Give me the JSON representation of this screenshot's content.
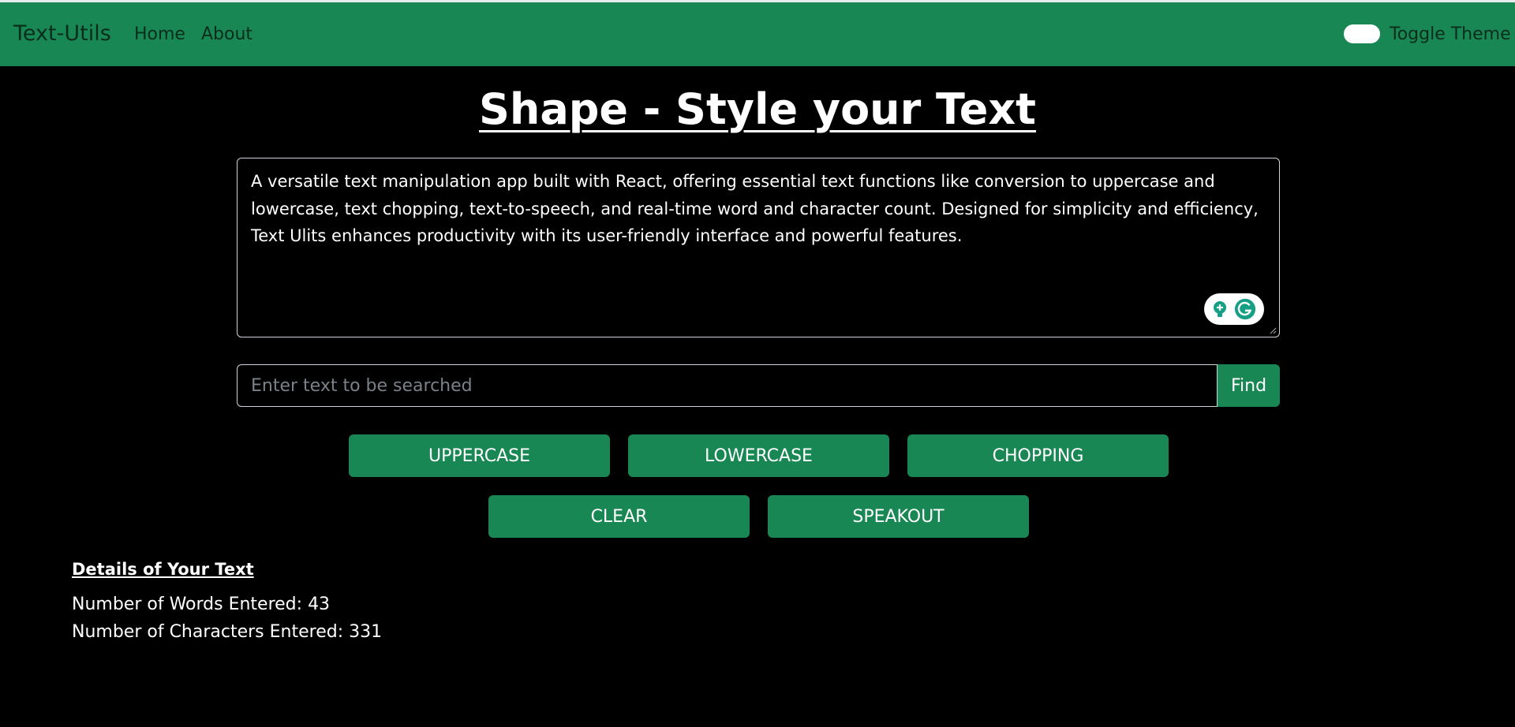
{
  "navbar": {
    "brand": "Text-Utils",
    "links": [
      "Home",
      "About"
    ],
    "toggle_label": "Toggle Theme"
  },
  "main": {
    "title": "Shape - Style your Text",
    "textarea_text": "A versatile text manipulation app built with React, offering essential text functions like conversion to uppercase and lowercase, text chopping, text-to-speech, and real-time word and character count. Designed for simplicity and efficiency, Text Ulits enhances productivity with its user-friendly interface and powerful features.",
    "search": {
      "placeholder": "Enter text to be searched",
      "value": "",
      "button_label": "Find"
    },
    "buttons": [
      "UPPERCASE",
      "LOWERCASE",
      "CHOPPING",
      "CLEAR",
      "SPEAKOUT"
    ]
  },
  "details": {
    "heading": "Details of Your Text",
    "words_label": "Number of Words Entered:",
    "words_count": "43",
    "chars_label": "Number of Characters Entered:",
    "chars_count": "331"
  },
  "colors": {
    "accent": "#198754",
    "background": "#000000",
    "text": "#ffffff",
    "grammarly": "#15a085"
  },
  "icons": [
    "lightbulb-icon",
    "grammarly-icon",
    "resize-handle-icon"
  ]
}
